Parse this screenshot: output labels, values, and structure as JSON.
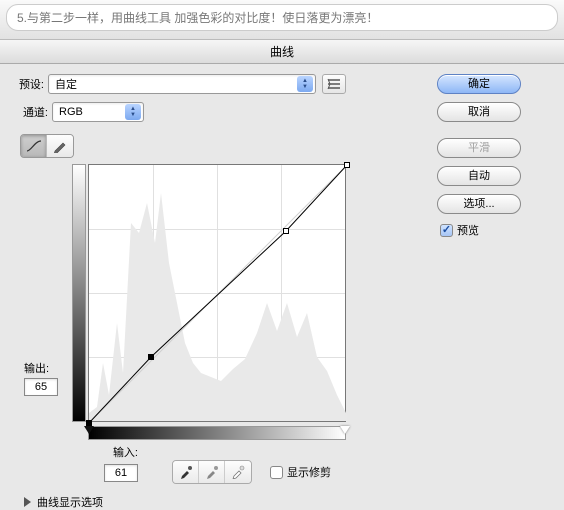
{
  "header": {
    "instruction": "5.与第二步一样，用曲线工具 加强色彩的对比度！使日落更为漂亮！",
    "title": "曲线"
  },
  "preset": {
    "label": "预设:",
    "value": "自定",
    "menu_icon": "preset-menu-icon"
  },
  "channel": {
    "label": "通道:",
    "value": "RGB"
  },
  "tools": {
    "curve_tool": "curve-tool",
    "pencil_tool": "pencil-tool"
  },
  "output": {
    "label": "输出:",
    "value": "65"
  },
  "input": {
    "label": "输入:",
    "value": "61"
  },
  "show_clipping": {
    "label": "显示修剪",
    "checked": false
  },
  "disclosure": {
    "label": "曲线显示选项"
  },
  "buttons": {
    "ok": "确定",
    "cancel": "取消",
    "smooth": "平滑",
    "auto": "自动",
    "options": "选项..."
  },
  "preview": {
    "label": "预览",
    "checked": true
  },
  "chart_data": {
    "type": "line",
    "title": "",
    "xlabel": "输入",
    "ylabel": "输出",
    "xlim": [
      0,
      255
    ],
    "ylim": [
      0,
      255
    ],
    "series": [
      {
        "name": "curve",
        "x": [
          0,
          61,
          195,
          255
        ],
        "y": [
          0,
          65,
          190,
          255
        ]
      }
    ],
    "control_points": [
      {
        "x": 0,
        "y": 0,
        "selected": false
      },
      {
        "x": 61,
        "y": 65,
        "selected": true
      },
      {
        "x": 195,
        "y": 190,
        "selected": false
      },
      {
        "x": 255,
        "y": 255,
        "selected": false
      }
    ],
    "grid": {
      "rows": 4,
      "cols": 4
    }
  }
}
